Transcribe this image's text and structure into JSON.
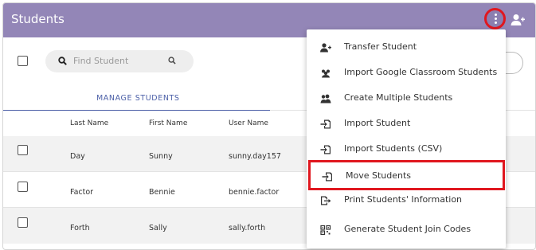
{
  "header": {
    "title": "Students",
    "kebab_icon": "kebab-menu-icon",
    "add_icon": "add-student-icon"
  },
  "toolbar": {
    "search_placeholder": "Find Student"
  },
  "tabs": [
    {
      "label": "MANAGE STUDENTS",
      "active": true
    }
  ],
  "table": {
    "columns": [
      "Last Name",
      "First Name",
      "User Name"
    ],
    "rows": [
      {
        "last": "Day",
        "first": "Sunny",
        "user": "sunny.day157"
      },
      {
        "last": "Factor",
        "first": "Bennie",
        "user": "bennie.factor"
      },
      {
        "last": "Forth",
        "first": "Sally",
        "user": "sally.forth"
      }
    ]
  },
  "menu": {
    "items": [
      {
        "label": "Transfer Student",
        "icon": "transfer-person-icon"
      },
      {
        "label": "Import Google Classroom Students",
        "icon": "group-import-icon"
      },
      {
        "label": "Create Multiple Students",
        "icon": "group-add-icon"
      },
      {
        "label": "Import Student",
        "icon": "import-icon"
      },
      {
        "label": "Import Students (CSV)",
        "icon": "import-csv-icon"
      },
      {
        "label": "Move Students",
        "icon": "move-icon",
        "highlighted": true
      },
      {
        "label": "Print Students' Information",
        "icon": "print-export-icon"
      },
      {
        "label": "Generate Student Join Codes",
        "icon": "qr-code-icon"
      }
    ]
  },
  "colors": {
    "header_bg": "#9386b7",
    "tab_accent": "#4b5fa7",
    "highlight": "#e0171f"
  }
}
